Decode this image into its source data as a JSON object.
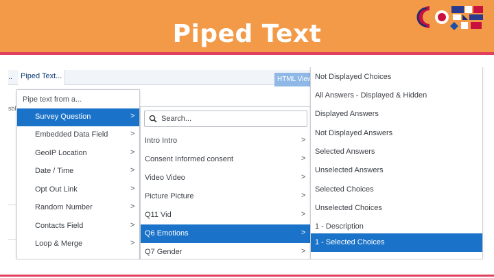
{
  "slide": {
    "title": "Piped Text",
    "colors": {
      "banner": "#f29a48",
      "accent_line": "#e0405e",
      "selection": "#1a73c9"
    }
  },
  "toolbar": {
    "prev_label": "..",
    "piped_label": "Piped Text...",
    "html_view_label": "HTML View"
  },
  "background_fragments": {
    "left_label": "sbl"
  },
  "panel_pipe_from": {
    "heading": "Pipe text from a...",
    "items": [
      {
        "label": "Survey Question",
        "selected": true
      },
      {
        "label": "Embedded Data Field"
      },
      {
        "label": "GeoIP Location"
      },
      {
        "label": "Date / Time"
      },
      {
        "label": "Opt Out Link"
      },
      {
        "label": "Random Number"
      },
      {
        "label": "Contacts Field"
      },
      {
        "label": "Loop & Merge"
      }
    ]
  },
  "panel_questions": {
    "search_placeholder": "Search...",
    "items": [
      {
        "label": "Intro Intro"
      },
      {
        "label": "Consent Informed consent"
      },
      {
        "label": "Video Video"
      },
      {
        "label": "Picture Picture"
      },
      {
        "label": "Q11 Vid"
      },
      {
        "label": "Q6 Emotions",
        "selected": true
      },
      {
        "label": "Q7 Gender"
      }
    ]
  },
  "panel_options": {
    "items": [
      {
        "label": "Not Displayed Choices"
      },
      {
        "label": "All Answers - Displayed & Hidden"
      },
      {
        "label": "Displayed Answers"
      },
      {
        "label": "Not Displayed Answers"
      },
      {
        "label": "Selected Answers"
      },
      {
        "label": "Unselected Answers"
      },
      {
        "label": "Selected Choices"
      },
      {
        "label": "Unselected Choices"
      },
      {
        "label": "1 - Description"
      },
      {
        "label": "1 - Selected Choices",
        "selected": true
      }
    ]
  },
  "chevron_glyph": ">",
  "icons": {
    "search": "search-icon",
    "chevron": "chevron-right-icon",
    "logo": "brand-logo"
  }
}
